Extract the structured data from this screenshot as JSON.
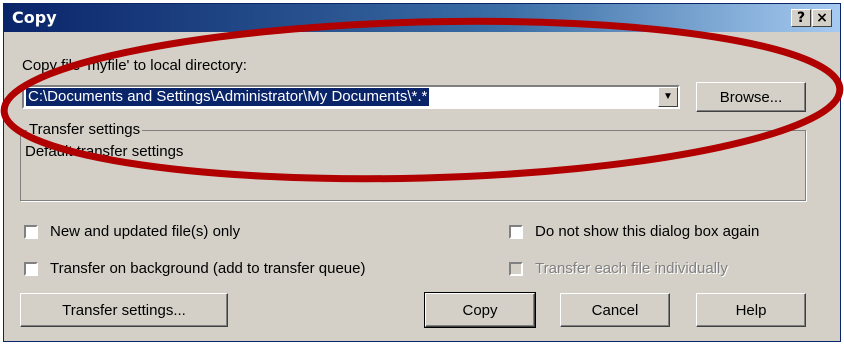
{
  "window": {
    "title": "Copy",
    "help_button": "?",
    "close_button": "×"
  },
  "copy_prompt": "Copy file 'myfile' to local directory:",
  "directory": {
    "value": "C:\\Documents and Settings\\Administrator\\My Documents\\*.*"
  },
  "browse_button": "Browse...",
  "transfer_group": {
    "caption": "Transfer settings",
    "body": "Default transfer settings"
  },
  "options": {
    "new_updated": "New and updated file(s) only",
    "background": "Transfer on background (add to transfer queue)",
    "do_not_show": "Do not show this dialog box again",
    "individually": "Transfer each file individually"
  },
  "buttons": {
    "transfer_settings": "Transfer settings...",
    "copy": "Copy",
    "cancel": "Cancel",
    "help": "Help"
  },
  "colors": {
    "annotation": "#b00000",
    "selection": "#0a246a",
    "face": "#d4d0c8"
  },
  "icons": {
    "dropdown": "triangle-down"
  }
}
